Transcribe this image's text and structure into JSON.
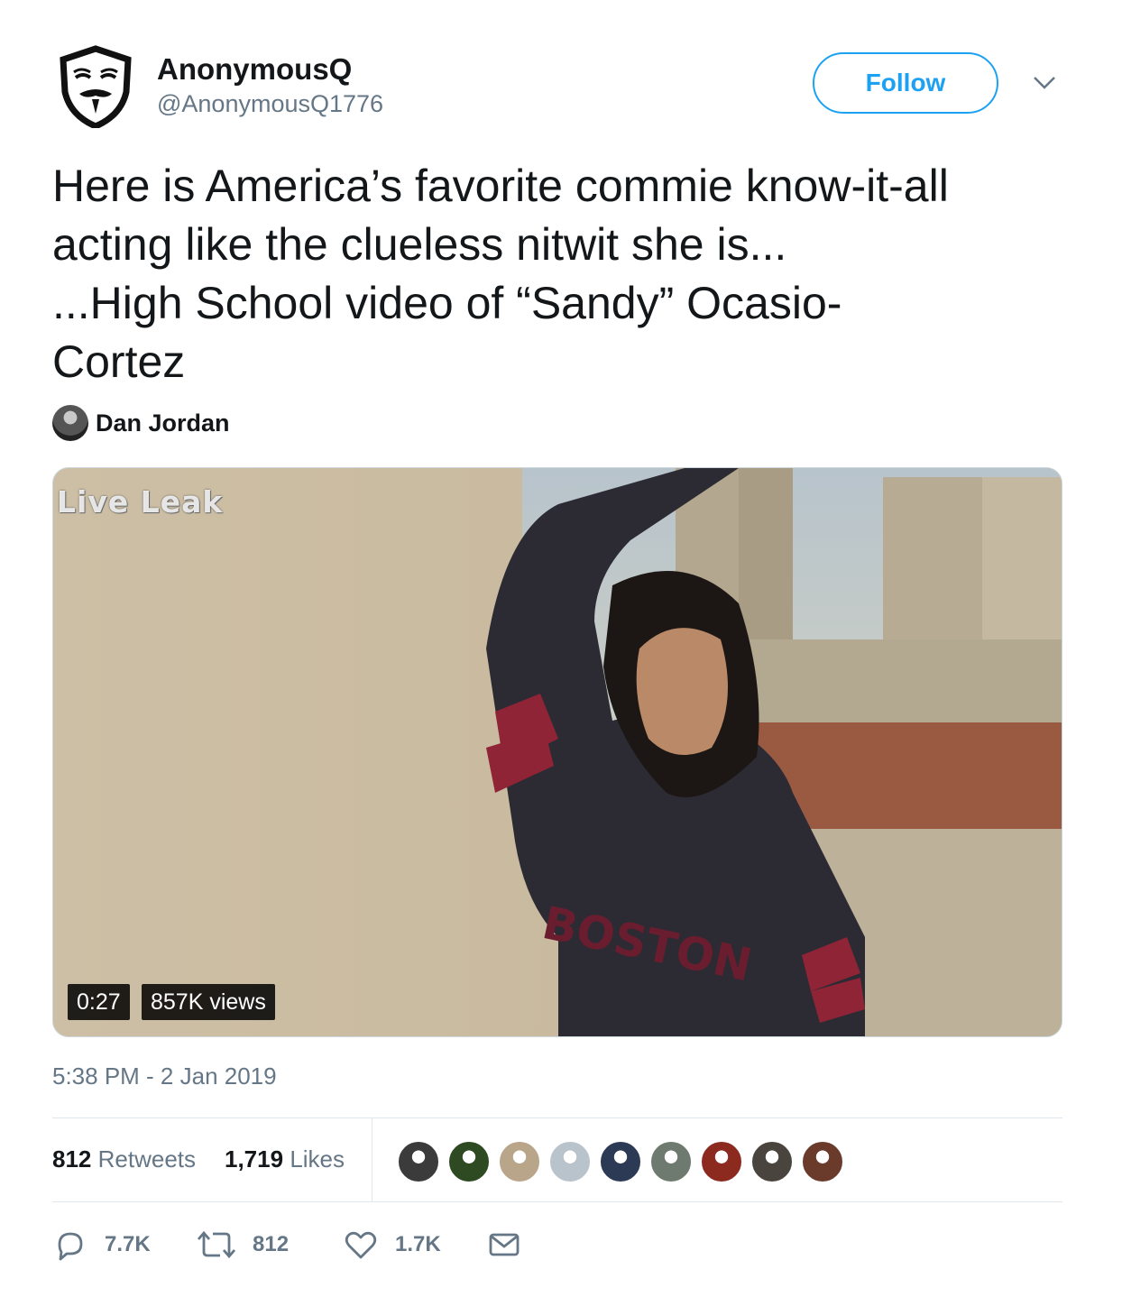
{
  "author": {
    "name": "AnonymousQ",
    "handle": "@AnonymousQ1776"
  },
  "follow_label": "Follow",
  "tweet_lines": [
    "Here is America’s favorite commie know-it-all",
    "acting like the clueless nitwit she is...",
    "...High School video of “Sandy” Ocasio-",
    "Cortez"
  ],
  "video": {
    "attribution_name": "Dan Jordan",
    "watermark": "Live Leak",
    "duration": "0:27",
    "views": "857K views"
  },
  "timestamp": "5:38 PM - 2 Jan 2019",
  "stats": {
    "retweets_count": "812",
    "retweets_label": "Retweets",
    "likes_count": "1,719",
    "likes_label": "Likes"
  },
  "liker_colors": [
    "#3b3b3b",
    "#2e4a22",
    "#b9a58a",
    "#b8c3cc",
    "#2c3a55",
    "#6e7a70",
    "#8c2a1f",
    "#4a443e",
    "#6a3b2a"
  ],
  "actions": {
    "reply_count": "7.7K",
    "retweet_count": "812",
    "like_count": "1.7K"
  },
  "colors": {
    "accent": "#1da1f2",
    "secondary_text": "#657786",
    "primary_text": "#14171a"
  }
}
